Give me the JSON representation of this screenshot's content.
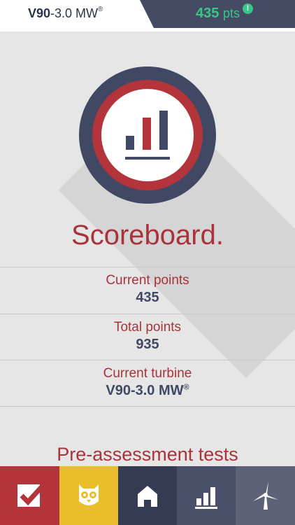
{
  "header": {
    "model_bold": "V90",
    "model_rest": "-3.0 MW",
    "model_mark": "®",
    "points_value": "435",
    "points_unit": "pts",
    "badge": "!"
  },
  "main": {
    "title": "Scoreboard.",
    "stats": [
      {
        "label": "Current points",
        "value": "435"
      },
      {
        "label": "Total points",
        "value": "935"
      },
      {
        "label": "Current turbine",
        "value": "V90-3.0 MW",
        "mark": "®"
      }
    ],
    "section_heading": "Pre-assessment tests"
  },
  "nav": {
    "tabs": [
      {
        "icon": "checkbox-icon",
        "color": "#b3343a"
      },
      {
        "icon": "owl-icon",
        "color": "#eabd2a"
      },
      {
        "icon": "home-icon",
        "color": "#353b52"
      },
      {
        "icon": "scoreboard-icon",
        "color": "#4a5069"
      },
      {
        "icon": "wind-turbine-icon",
        "color": "#5d6278"
      }
    ]
  },
  "colors": {
    "accent_red": "#a8333a",
    "navy": "#414864",
    "points_green": "#39c68a"
  }
}
